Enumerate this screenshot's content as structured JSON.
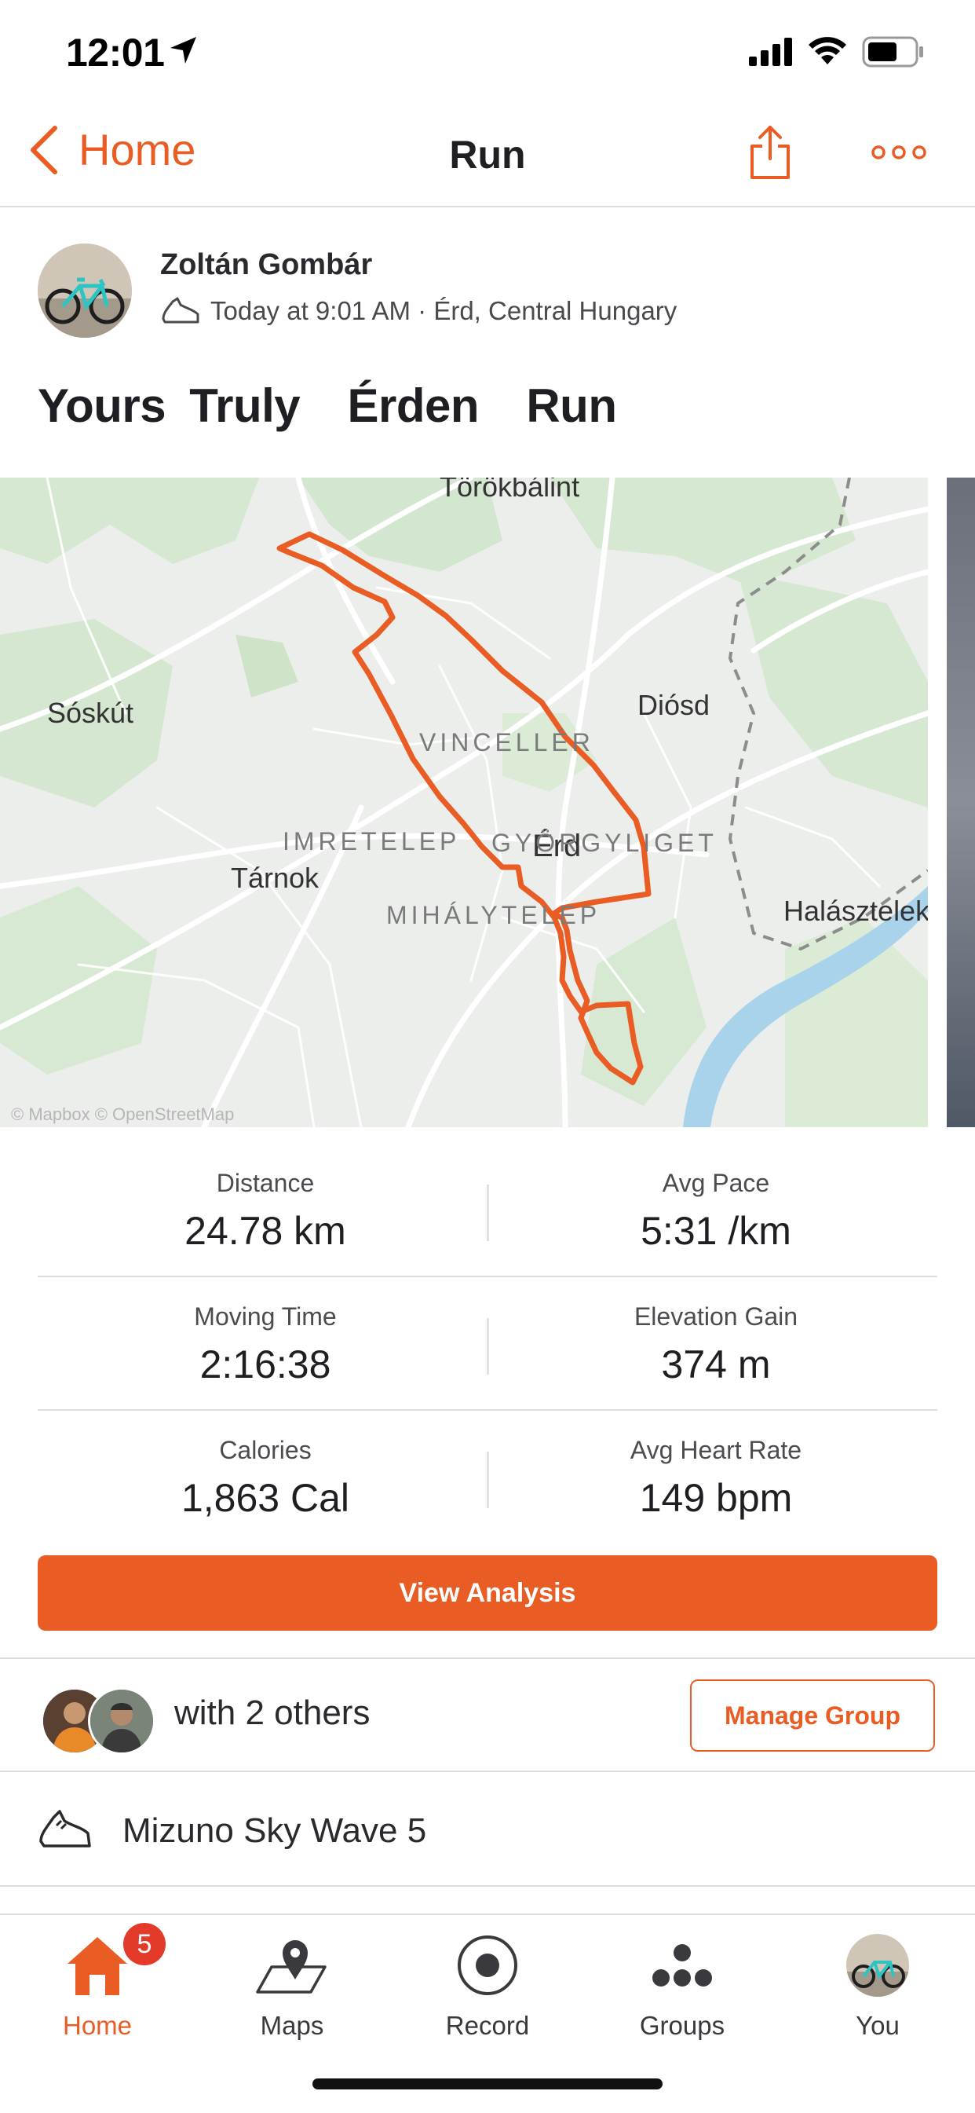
{
  "status_bar": {
    "time": "12:01"
  },
  "nav": {
    "back_label": "Home",
    "title": "Run"
  },
  "activity": {
    "athlete_name": "Zoltán Gombár",
    "meta": "Today at 9:01 AM · Érd, Central Hungary",
    "title": "Yours Truly  Érden  Run"
  },
  "map": {
    "labels": {
      "torokbalint": "Törökbálint",
      "soskut": "Sóskút",
      "diosd": "Diósd",
      "vincellér": "VINCELLÉR",
      "gyorgyliget": "GYÖRGYLIGET",
      "imretelep": "IMRETELEP",
      "erd": "Érd",
      "tarnok": "Tárnok",
      "mihalytelep": "MIHÁLYTELEP",
      "halasztelek": "Halásztelek"
    },
    "attribution": "© Mapbox © OpenStreetMap",
    "route_color": "#e95d25"
  },
  "stats": [
    {
      "label": "Distance",
      "value": "24.78 km"
    },
    {
      "label": "Avg Pace",
      "value": "5:31 /km"
    },
    {
      "label": "Moving Time",
      "value": "2:16:38"
    },
    {
      "label": "Elevation Gain",
      "value": "374 m"
    },
    {
      "label": "Calories",
      "value": "1,863 Cal"
    },
    {
      "label": "Avg Heart Rate",
      "value": "149 bpm"
    }
  ],
  "view_analysis_label": "View Analysis",
  "group": {
    "text": "with 2 others",
    "manage_label": "Manage Group"
  },
  "gear": {
    "name": "Mizuno Sky Wave 5"
  },
  "tabbar": {
    "home": {
      "label": "Home",
      "badge": "5"
    },
    "maps": {
      "label": "Maps"
    },
    "record": {
      "label": "Record"
    },
    "groups": {
      "label": "Groups"
    },
    "you": {
      "label": "You"
    }
  },
  "colors": {
    "accent": "#e95d25",
    "badge": "#e43a2a"
  }
}
